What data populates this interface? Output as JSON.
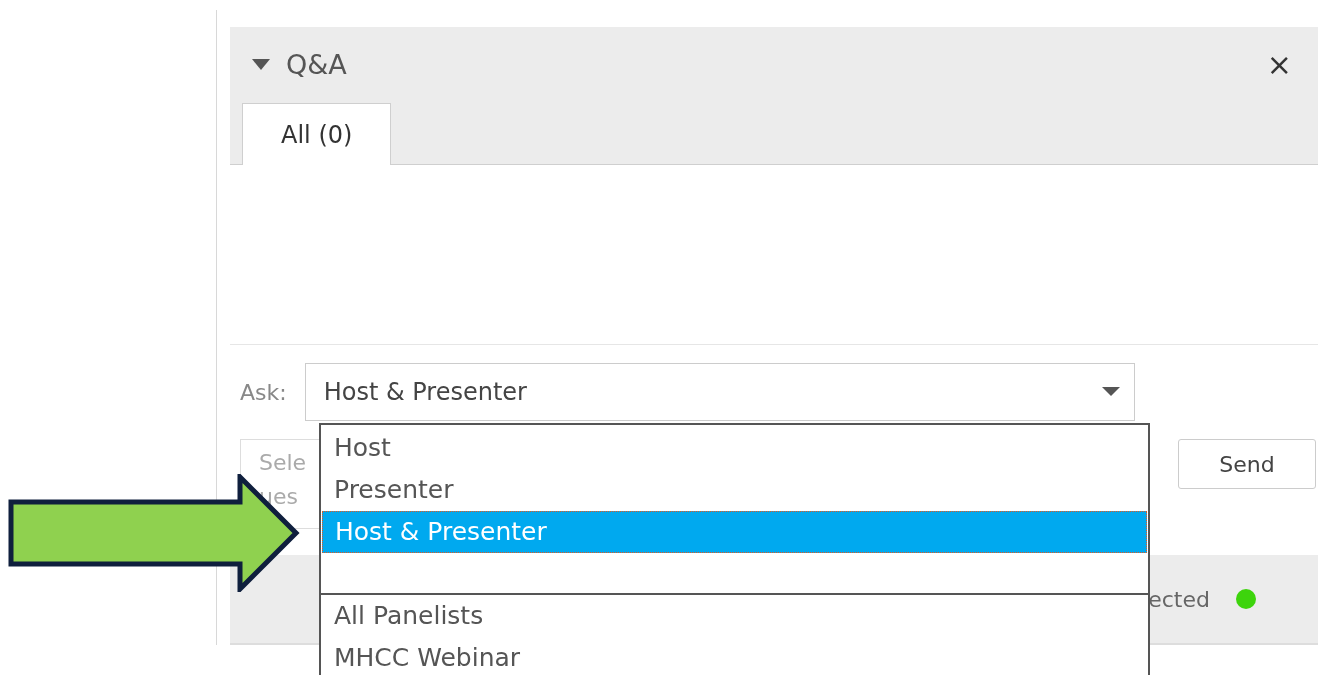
{
  "panel": {
    "title": "Q&A",
    "expanded": true,
    "close": "×"
  },
  "tabs": [
    {
      "label": "All (0)",
      "selected": true
    }
  ],
  "ask": {
    "label": "Ask:",
    "value": "Host & Presenter"
  },
  "question_field": {
    "placeholder_lines": [
      "Sele",
      "ues"
    ]
  },
  "send_button": "Send",
  "status": {
    "text": "ected",
    "color": "#3dd40c"
  },
  "dropdown": {
    "options": [
      {
        "kind": "option",
        "label": "Host",
        "selected": false
      },
      {
        "kind": "option",
        "label": "Presenter",
        "selected": false
      },
      {
        "kind": "option",
        "label": "Host & Presenter",
        "selected": true
      },
      {
        "kind": "separator"
      },
      {
        "kind": "option",
        "label": "All Panelists",
        "selected": false
      },
      {
        "kind": "option",
        "label": "MHCC Webinar",
        "selected": false
      }
    ]
  }
}
